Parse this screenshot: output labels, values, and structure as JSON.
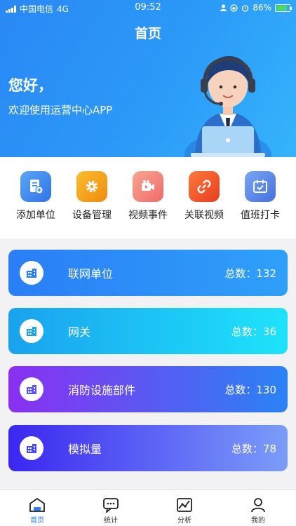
{
  "status_bar": {
    "carrier": "中国电信",
    "network": "4G",
    "time": "09:52",
    "battery": "86%"
  },
  "header": {
    "title": "首页",
    "greeting": "您好，",
    "welcome": "欢迎使用运营中心APP"
  },
  "quick_actions": [
    {
      "label": "添加单位",
      "icon": "add-unit-icon",
      "color": "#3f8cf0"
    },
    {
      "label": "设备管理",
      "icon": "gear-icon",
      "color": "#f7a21b"
    },
    {
      "label": "视频事件",
      "icon": "video-camera-icon",
      "color": "#f47b6f"
    },
    {
      "label": "关联视频",
      "icon": "link-icon",
      "color": "#f25a2a"
    },
    {
      "label": "值班打卡",
      "icon": "calendar-check-icon",
      "color": "#4c7ee8"
    }
  ],
  "summary_cards": [
    {
      "name": "联网单位",
      "count_label": "总数：132",
      "colors": [
        "#2a7ef6",
        "#2fa0fa"
      ]
    },
    {
      "name": "网关",
      "count_label": "总数：36",
      "colors": [
        "#1aa2ee",
        "#1ee3fb"
      ]
    },
    {
      "name": "消防设施部件",
      "count_label": "总数：130",
      "colors": [
        "#8a2ff1",
        "#2a83f4"
      ]
    },
    {
      "name": "模拟量",
      "count_label": "总数：78",
      "colors": [
        "#3b26f0",
        "#7b9df9"
      ]
    }
  ],
  "tab_bar": [
    {
      "label": "首页",
      "icon": "home-icon",
      "active": true
    },
    {
      "label": "统计",
      "icon": "chat-stats-icon",
      "active": false
    },
    {
      "label": "分析",
      "icon": "chart-analysis-icon",
      "active": false
    },
    {
      "label": "我的",
      "icon": "user-icon",
      "active": false
    }
  ]
}
